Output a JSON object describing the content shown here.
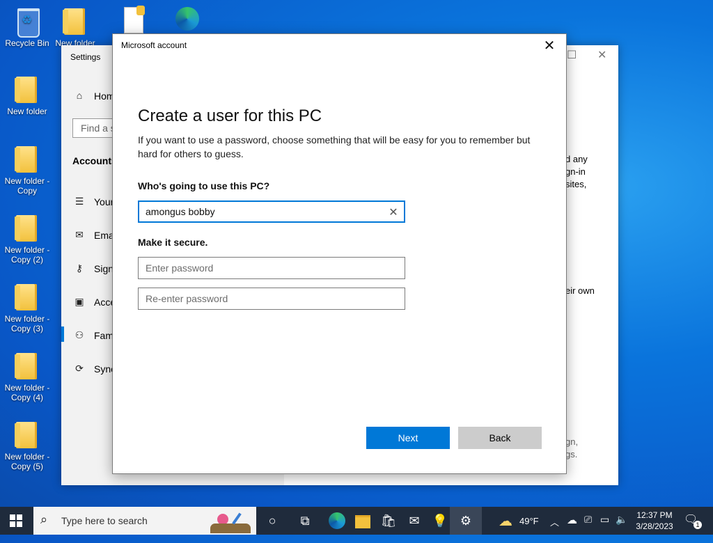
{
  "desktop": {
    "icons": [
      {
        "label": "Recycle Bin"
      },
      {
        "label": "New folder"
      },
      {
        "label": "New folder - Copy"
      },
      {
        "label": "New folder - Copy (2)"
      },
      {
        "label": "New folder - Copy (3)"
      },
      {
        "label": "New folder - Copy (4)"
      },
      {
        "label": "New folder - Copy (5)"
      }
    ],
    "top_partial_label": "New folder"
  },
  "settings": {
    "title": "Settings",
    "find_placeholder": "Find a s",
    "section": "Accounts",
    "nav": [
      {
        "icon": "home-icon",
        "label": "Hom"
      },
      {
        "icon": "your-info-icon",
        "label": "Your"
      },
      {
        "icon": "email-icon",
        "label": "Ema"
      },
      {
        "icon": "key-icon",
        "label": "Sign"
      },
      {
        "icon": "briefcase-icon",
        "label": "Acce"
      },
      {
        "icon": "family-icon",
        "label": "Fam"
      },
      {
        "icon": "sync-icon",
        "label": "Sync"
      }
    ],
    "right_fragments": {
      "line1": "d any",
      "line2": "gn-in",
      "line3": "sites,",
      "line4": "eir own",
      "line5": "gn,",
      "line6": "gs."
    }
  },
  "dialog": {
    "title": "Microsoft account",
    "heading": "Create a user for this PC",
    "description": "If you want to use a password, choose something that will be easy for you to remember but hard for others to guess.",
    "who_label": "Who's going to use this PC?",
    "username_value": "amongus bobby",
    "secure_label": "Make it secure.",
    "password_placeholder": "Enter password",
    "reenter_placeholder": "Re-enter password",
    "next_label": "Next",
    "back_label": "Back",
    "close_glyph": "✕",
    "clear_glyph": "✕"
  },
  "taskbar": {
    "search_placeholder": "Type here to search",
    "weather_temp": "49°F",
    "time": "12:37 PM",
    "date": "3/28/2023",
    "notification_count": "1"
  },
  "colors": {
    "accent": "#0078d7",
    "taskbar": "#1f2b3c"
  }
}
